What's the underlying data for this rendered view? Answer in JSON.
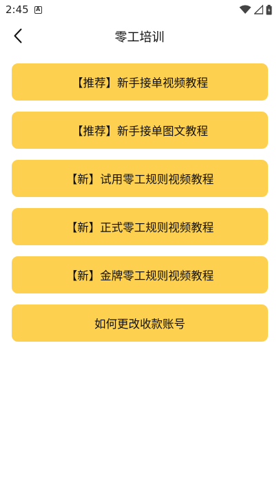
{
  "status": {
    "time": "2:45",
    "notification_badge": "A"
  },
  "header": {
    "title": "零工培训"
  },
  "menu": {
    "items": [
      {
        "label": "【推荐】新手接单视频教程"
      },
      {
        "label": "【推荐】新手接单图文教程"
      },
      {
        "label": "【新】试用零工规则视频教程"
      },
      {
        "label": "【新】正式零工规则视频教程"
      },
      {
        "label": "【新】金牌零工规则视频教程"
      },
      {
        "label": "如何更改收款账号"
      }
    ]
  },
  "colors": {
    "button_bg": "#fdd14f",
    "background": "#ffffff",
    "text": "#111111"
  },
  "icons": [
    "back-arrow-icon",
    "wifi-icon",
    "signal-icon",
    "battery-icon"
  ]
}
